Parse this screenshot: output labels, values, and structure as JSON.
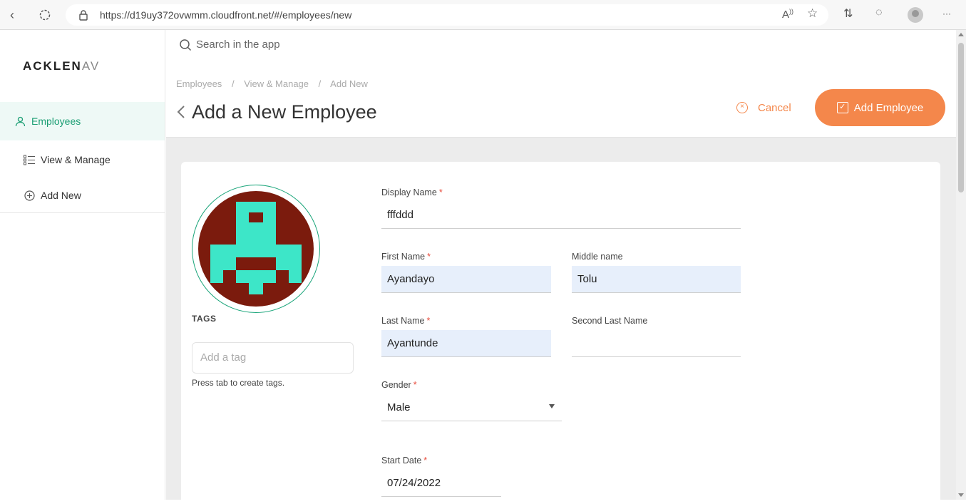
{
  "browser": {
    "url": "https://d19uy372ovwmm.cloudfront.net/#/employees/new"
  },
  "brand": {
    "logo_main": "ACKLEN",
    "logo_tail": "AV"
  },
  "sidebar": {
    "items": [
      {
        "label": "Employees",
        "icon": "person-icon",
        "active": true
      },
      {
        "label": "View & Manage",
        "icon": "list-icon",
        "active": false
      },
      {
        "label": "Add New",
        "icon": "plus-circle-icon",
        "active": false
      }
    ]
  },
  "search": {
    "placeholder": "Search in the app"
  },
  "breadcrumb": [
    "Employees",
    "/",
    "View & Manage",
    "/",
    "Add New"
  ],
  "page": {
    "title": "Add a New Employee"
  },
  "actions": {
    "cancel_label": "Cancel",
    "add_label": "Add Employee"
  },
  "tags": {
    "label": "TAGS",
    "placeholder": "Add a tag",
    "hint": "Press tab to create tags."
  },
  "form": {
    "display_name": {
      "label": "Display Name",
      "required": "*",
      "value": "fffddd"
    },
    "first_name": {
      "label": "First Name",
      "required": "*",
      "value": "Ayandayo"
    },
    "middle_name": {
      "label": "Middle name",
      "value": "Tolu"
    },
    "last_name": {
      "label": "Last Name",
      "required": "*",
      "value": "Ayantunde"
    },
    "second_last_name": {
      "label": "Second Last Name",
      "value": ""
    },
    "gender": {
      "label": "Gender",
      "required": "*",
      "value": "Male"
    },
    "start_date": {
      "label": "Start Date",
      "required": "*",
      "value": "07/24/2022"
    }
  },
  "colors": {
    "accent": "#f4874b",
    "active_green": "#1a9e73",
    "avatar_bg": "#7b1b0d",
    "avatar_fg": "#3de6c8"
  }
}
